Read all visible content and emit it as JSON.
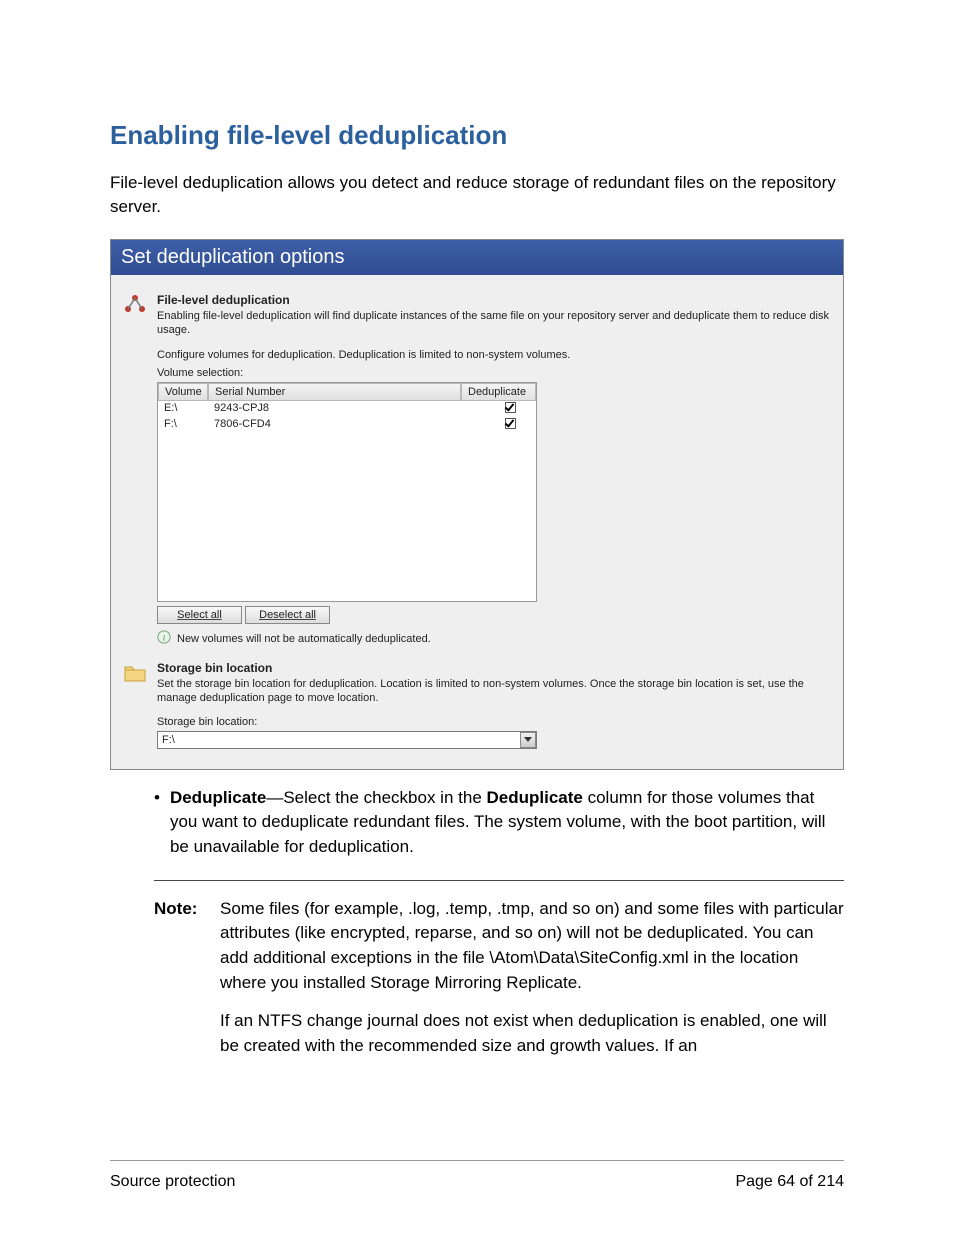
{
  "heading": "Enabling file-level deduplication",
  "intro": "File-level deduplication allows you detect and reduce storage of redundant files on the repository server.",
  "panel": {
    "title": "Set deduplication options",
    "dedup_section": {
      "title": "File-level deduplication",
      "desc": "Enabling file-level deduplication will find duplicate instances of the same file on your repository server and deduplicate them to reduce disk usage.",
      "configure_line": "Configure volumes for deduplication.  Deduplication is limited to non-system volumes.",
      "selection_label": "Volume selection:",
      "columns": {
        "volume": "Volume",
        "serial": "Serial Number",
        "dedup": "Deduplicate"
      },
      "rows": [
        {
          "volume": "E:\\",
          "serial": "9243-CPJ8",
          "checked": true
        },
        {
          "volume": "F:\\",
          "serial": "7806-CFD4",
          "checked": true
        }
      ],
      "select_all": "Select all",
      "deselect_all": "Deselect all",
      "info": "New volumes will not be automatically deduplicated."
    },
    "storage_section": {
      "title": "Storage bin location",
      "desc": "Set the storage bin location for deduplication. Location is limited to non-system volumes. Once the storage bin location is set, use the manage deduplication page to move location.",
      "label": "Storage bin location:",
      "value": "F:\\"
    }
  },
  "bullet": {
    "lead": "Deduplicate",
    "rest": "—Select the checkbox in the ",
    "bold2": "Deduplicate",
    "rest2": " column for those volumes that you want to deduplicate redundant files. The system volume, with the boot partition, will be unavailable for deduplication."
  },
  "note": {
    "label": "Note:",
    "p1": "Some files (for example, .log, .temp, .tmp, and so on) and some files with particular attributes (like encrypted, reparse, and so on) will not be deduplicated. You can add additional exceptions in the file \\Atom\\Data\\SiteConfig.xml in the location where you installed Storage Mirroring Replicate.",
    "p2": "If an NTFS change journal does not exist when deduplication is enabled, one will be created with the recommended size and growth values. If an"
  },
  "footer": {
    "left": "Source protection",
    "right": "Page 64 of 214"
  }
}
